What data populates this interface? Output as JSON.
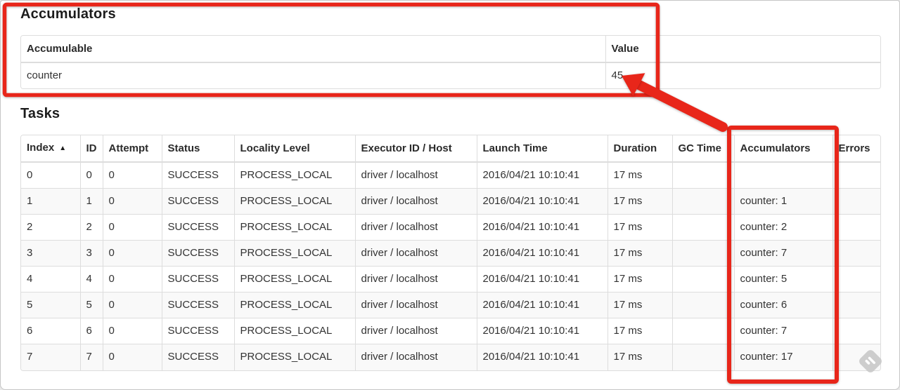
{
  "accumulators_section": {
    "heading": "Accumulators",
    "table": {
      "headers": [
        "Accumulable",
        "Value"
      ],
      "rows": [
        {
          "accumulable": "counter",
          "value": "45"
        }
      ]
    }
  },
  "tasks_section": {
    "heading": "Tasks",
    "table": {
      "headers": [
        "Index",
        "ID",
        "Attempt",
        "Status",
        "Locality Level",
        "Executor ID / Host",
        "Launch Time",
        "Duration",
        "GC Time",
        "Accumulators",
        "Errors"
      ],
      "sort_icon": "▲",
      "rows": [
        {
          "index": "0",
          "id": "0",
          "attempt": "0",
          "status": "SUCCESS",
          "locality": "PROCESS_LOCAL",
          "executor": "driver / localhost",
          "launch": "2016/04/21 10:10:41",
          "duration": "17 ms",
          "gc": "",
          "accum": "",
          "errors": ""
        },
        {
          "index": "1",
          "id": "1",
          "attempt": "0",
          "status": "SUCCESS",
          "locality": "PROCESS_LOCAL",
          "executor": "driver / localhost",
          "launch": "2016/04/21 10:10:41",
          "duration": "17 ms",
          "gc": "",
          "accum": "counter: 1",
          "errors": ""
        },
        {
          "index": "2",
          "id": "2",
          "attempt": "0",
          "status": "SUCCESS",
          "locality": "PROCESS_LOCAL",
          "executor": "driver / localhost",
          "launch": "2016/04/21 10:10:41",
          "duration": "17 ms",
          "gc": "",
          "accum": "counter: 2",
          "errors": ""
        },
        {
          "index": "3",
          "id": "3",
          "attempt": "0",
          "status": "SUCCESS",
          "locality": "PROCESS_LOCAL",
          "executor": "driver / localhost",
          "launch": "2016/04/21 10:10:41",
          "duration": "17 ms",
          "gc": "",
          "accum": "counter: 7",
          "errors": ""
        },
        {
          "index": "4",
          "id": "4",
          "attempt": "0",
          "status": "SUCCESS",
          "locality": "PROCESS_LOCAL",
          "executor": "driver / localhost",
          "launch": "2016/04/21 10:10:41",
          "duration": "17 ms",
          "gc": "",
          "accum": "counter: 5",
          "errors": ""
        },
        {
          "index": "5",
          "id": "5",
          "attempt": "0",
          "status": "SUCCESS",
          "locality": "PROCESS_LOCAL",
          "executor": "driver / localhost",
          "launch": "2016/04/21 10:10:41",
          "duration": "17 ms",
          "gc": "",
          "accum": "counter: 6",
          "errors": ""
        },
        {
          "index": "6",
          "id": "6",
          "attempt": "0",
          "status": "SUCCESS",
          "locality": "PROCESS_LOCAL",
          "executor": "driver / localhost",
          "launch": "2016/04/21 10:10:41",
          "duration": "17 ms",
          "gc": "",
          "accum": "counter: 7",
          "errors": ""
        },
        {
          "index": "7",
          "id": "7",
          "attempt": "0",
          "status": "SUCCESS",
          "locality": "PROCESS_LOCAL",
          "executor": "driver / localhost",
          "launch": "2016/04/21 10:10:41",
          "duration": "17 ms",
          "gc": "",
          "accum": "counter: 17",
          "errors": ""
        }
      ]
    }
  },
  "annotations": {
    "color": "#e8261a",
    "highlight_targets": [
      "accumulators-section",
      "tasks-accumulators-column"
    ]
  },
  "watermark": {
    "color": "#cbcbcb",
    "mark_color": "#ffffff"
  }
}
